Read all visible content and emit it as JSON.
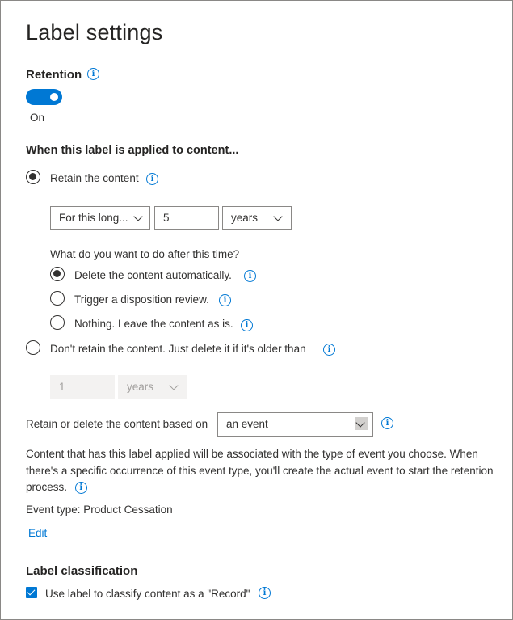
{
  "page_title": "Label settings",
  "retention": {
    "heading": "Retention",
    "toggle_state": "On",
    "toggle_on": true
  },
  "applied": {
    "heading": "When this label is applied to content...",
    "retain_option": "Retain the content",
    "duration_select": "For this long...",
    "duration_value": "5",
    "duration_unit": "years",
    "after_question": "What do you want to do after this time?",
    "after_options": [
      "Delete the content automatically.",
      "Trigger a disposition review.",
      "Nothing. Leave the content as is."
    ],
    "delete_option": "Don't retain the content. Just delete it if it's older than",
    "delete_value": "1",
    "delete_unit": "years"
  },
  "based_on": {
    "label": "Retain or delete the content based on",
    "value": "an event"
  },
  "description": "Content that has this label applied will be associated with the type of event you choose. When there's a specific occurrence of this event type, you'll create the actual event to start the retention process.",
  "event_type": "Event type: Product Cessation",
  "edit_link": "Edit",
  "classification": {
    "heading": "Label classification",
    "checkbox_label": "Use label to classify content as a \"Record\"",
    "checked": true
  },
  "colors": {
    "accent": "#0078d4",
    "text": "#323130",
    "disabled_bg": "#f3f2f1"
  }
}
